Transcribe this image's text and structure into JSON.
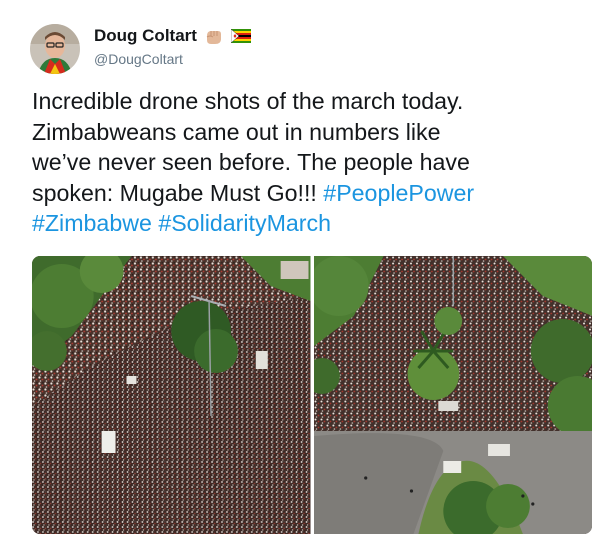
{
  "tweet": {
    "author_name": "Doug Coltart",
    "handle": "@DougColtart",
    "emoji_icons": [
      "raised-fist-icon",
      "zimbabwe-flag-icon"
    ],
    "text_lines": [
      [
        "Incredible drone shots of the march today."
      ],
      [
        "Zimbabweans came out in numbers like"
      ],
      [
        "we’ve never seen before. The people have"
      ],
      [
        "spoken: Mugabe Must Go!!! ",
        "#PeoplePower"
      ],
      [
        "#Zimbabwe",
        " ",
        "#SolidarityMarch"
      ]
    ],
    "hashtags": [
      "#PeoplePower",
      "#Zimbabwe",
      "#SolidarityMarch"
    ],
    "media": [
      {
        "name": "drone-photo-left",
        "subject": "aerial view of crowd filling a tree-lined street"
      },
      {
        "name": "drone-photo-right",
        "subject": "aerial view of crowd on road around palm-tree roundabout"
      }
    ]
  },
  "colors": {
    "text": "#14171a",
    "secondary": "#657786",
    "link": "#1b95e0",
    "crowd_dark": "#3a2a26",
    "crowd_light": "#e8e0da",
    "tree": "#3f6b2c",
    "road": "#8c8a86"
  }
}
